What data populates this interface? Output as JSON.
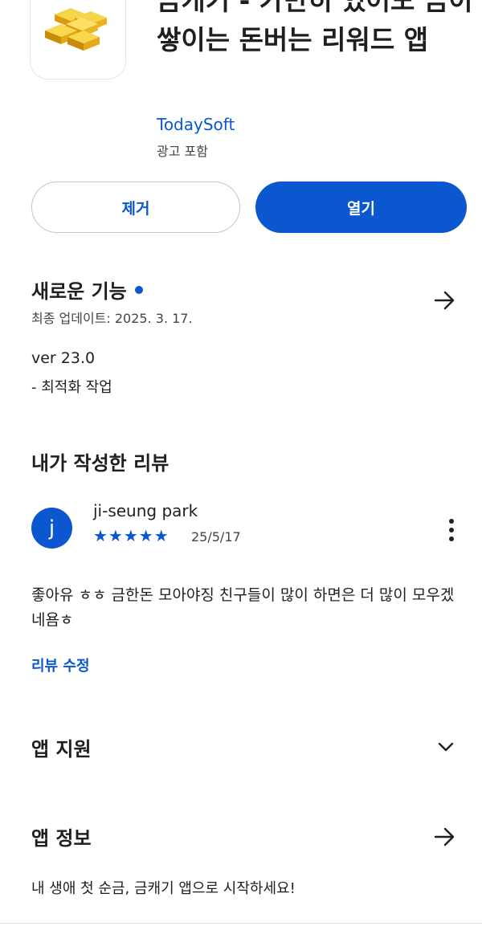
{
  "app": {
    "title": "금캐기 - 가만히 있어도 금이 쌓이는 돈버는 리워드 앱",
    "developer": "TodaySoft",
    "ads_label": "광고 포함",
    "icon": "gold-bars-icon"
  },
  "actions": {
    "remove_label": "제거",
    "open_label": "열기"
  },
  "whats_new": {
    "title": "새로운 기능",
    "updated": "최종 업데이트: 2025. 3. 17.",
    "version": "ver 23.0",
    "notes": "- 최적화 작업"
  },
  "my_review": {
    "title": "내가 작성한 리뷰",
    "avatar_letter": "j",
    "reviewer": "ji-seung park",
    "rating": 5,
    "stars": "★★★★★",
    "date": "25/5/17",
    "text": "좋아유 ㅎㅎ 금한돈 모아야징 친구들이 많이 하면은 더 많이 모우겠네욤ㅎ",
    "edit_label": "리뷰 수정"
  },
  "app_support": {
    "title": "앱 지원"
  },
  "app_info": {
    "title": "앱 정보",
    "description": "내 생애 첫 순금, 금캐기 앱으로 시작하세요!"
  },
  "colors": {
    "accent": "#0b57d0",
    "text": "#1f1f1f",
    "secondary": "#444444"
  }
}
